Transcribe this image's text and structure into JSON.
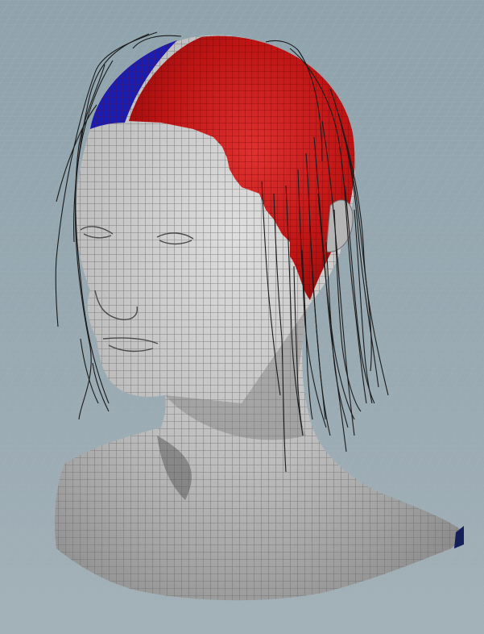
{
  "viewport": {
    "view": "perspective",
    "background_color": "#8fa3ad",
    "grid_color": "#aab6bd"
  },
  "scene": {
    "model": {
      "skin_color": "#b9b9b9",
      "wire_color": "#6e6e6e",
      "scalp_selection_red": "#c81414",
      "scalp_selection_blue": "#1418b4",
      "hair_guide_color": "#1a1a1a",
      "hair_guide_count": 40
    }
  }
}
